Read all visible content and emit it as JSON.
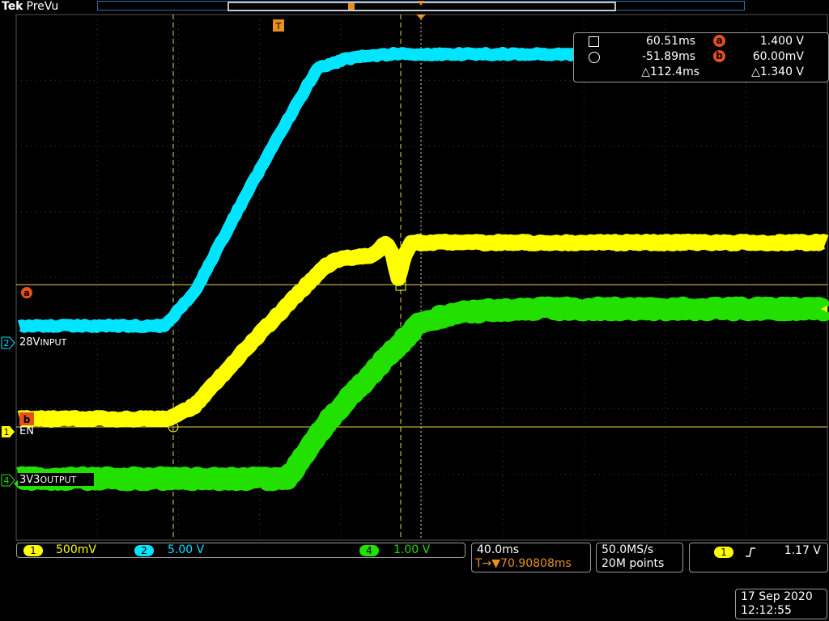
{
  "header": {
    "brand": "Tek",
    "mode": "PreVu",
    "trigger_marker": "T"
  },
  "colors": {
    "ch1": "#ffff00",
    "ch2": "#00e5ff",
    "ch4": "#22e000",
    "cursor": "#e8501a",
    "grid": "#3a3a3a"
  },
  "cursor_readout": {
    "time_a": "60.51ms",
    "volt_a": "1.400 V",
    "time_b": "-51.89ms",
    "volt_b": "60.00mV",
    "delta_time": "△112.4ms",
    "delta_volt": "△1.340 V",
    "badge_a": "a",
    "badge_b": "b"
  },
  "channels": {
    "ch2": {
      "num": "2",
      "name": "28V",
      "sub": "INPUT",
      "scale": "5.00 V"
    },
    "ch1": {
      "num": "1",
      "name": "EN",
      "sub": "",
      "scale": "500mV"
    },
    "ch4": {
      "num": "4",
      "name": "3V3",
      "sub": "OUTPUT",
      "scale": "1.00 V"
    }
  },
  "timebase": {
    "scale": "40.0ms",
    "position": "T→▼70.90808ms"
  },
  "acquisition": {
    "rate": "50.0MS/s",
    "points": "20M points"
  },
  "trigger": {
    "source": "1",
    "level": "1.17 V"
  },
  "datetime": {
    "date": "17 Sep  2020",
    "time": "12:12:55"
  }
}
